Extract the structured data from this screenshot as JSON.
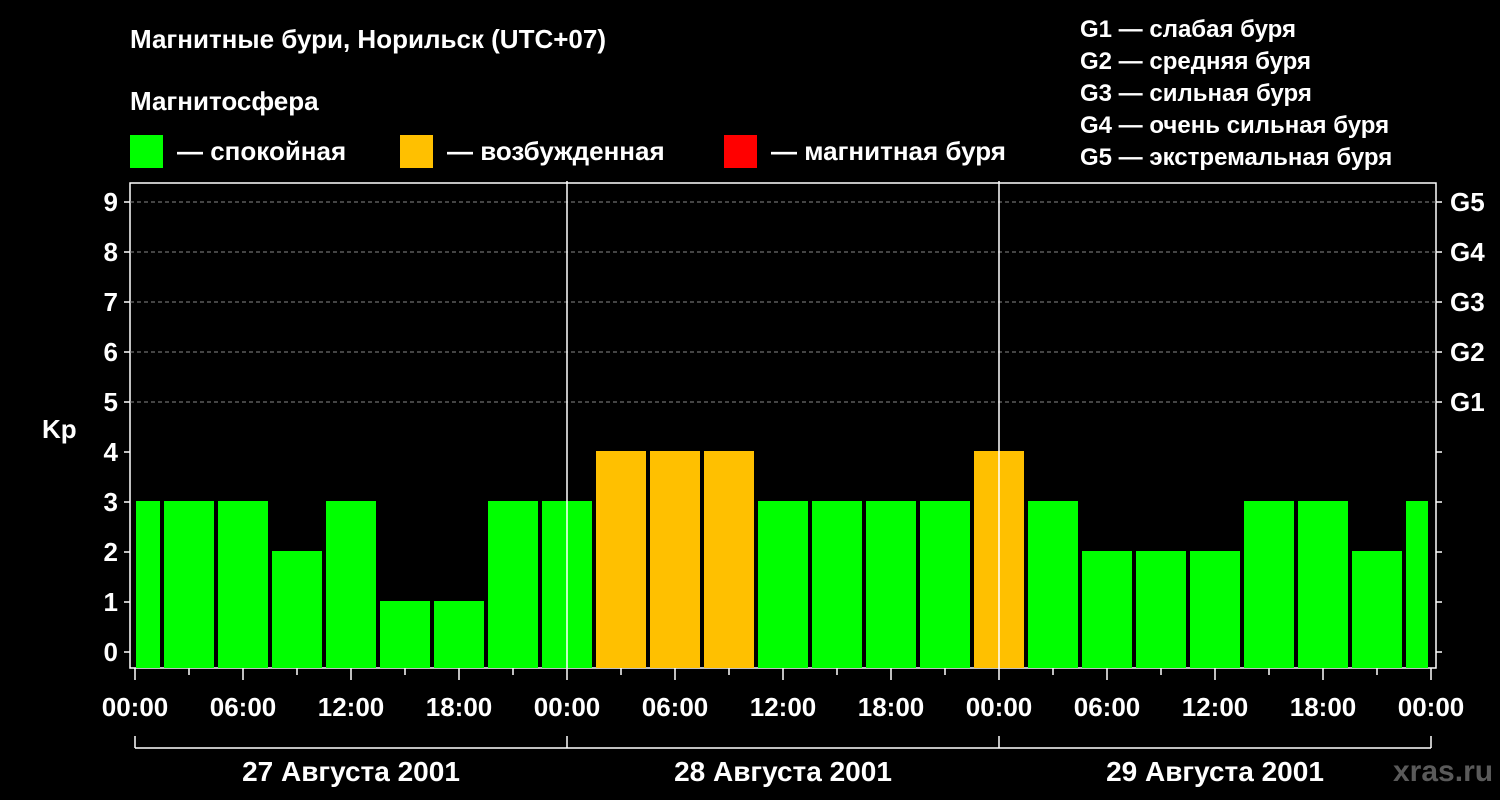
{
  "chart_data": {
    "type": "bar",
    "title": "Магнитные бури, Норильск (UTC+07)",
    "subtitle": "Магнитосфера",
    "ylabel": "Kp",
    "ylim": [
      0,
      9
    ],
    "yticks": [
      "0",
      "1",
      "2",
      "3",
      "4",
      "5",
      "6",
      "7",
      "8",
      "9"
    ],
    "xticks": [
      "00:00",
      "06:00",
      "12:00",
      "18:00",
      "00:00",
      "06:00",
      "12:00",
      "18:00",
      "00:00",
      "06:00",
      "12:00",
      "18:00",
      "00:00"
    ],
    "days": [
      "27 Августа 2001",
      "28 Августа 2001",
      "29 Августа 2001"
    ],
    "g_axis": [
      {
        "kp": 5,
        "label": "G1"
      },
      {
        "kp": 6,
        "label": "G2"
      },
      {
        "kp": 7,
        "label": "G3"
      },
      {
        "kp": 8,
        "label": "G4"
      },
      {
        "kp": 9,
        "label": "G5"
      }
    ],
    "values": [
      3,
      3,
      3,
      2,
      3,
      1,
      1,
      3,
      3,
      4,
      4,
      4,
      3,
      3,
      3,
      3,
      4,
      3,
      2,
      2,
      2,
      3,
      3,
      2,
      3
    ],
    "colors": {
      "calm": "#00ff00",
      "excited": "#ffc000",
      "storm": "#ff0000"
    },
    "grid": true
  },
  "legend": {
    "calm": "— спокойная",
    "excited": "— возбужденная",
    "storm": "— магнитная буря"
  },
  "g_legend": [
    "G1 — слабая буря",
    "G2 — средняя буря",
    "G3 — сильная буря",
    "G4 — очень сильная буря",
    "G5 — экстремальная буря"
  ],
  "watermark": "xras.ru"
}
